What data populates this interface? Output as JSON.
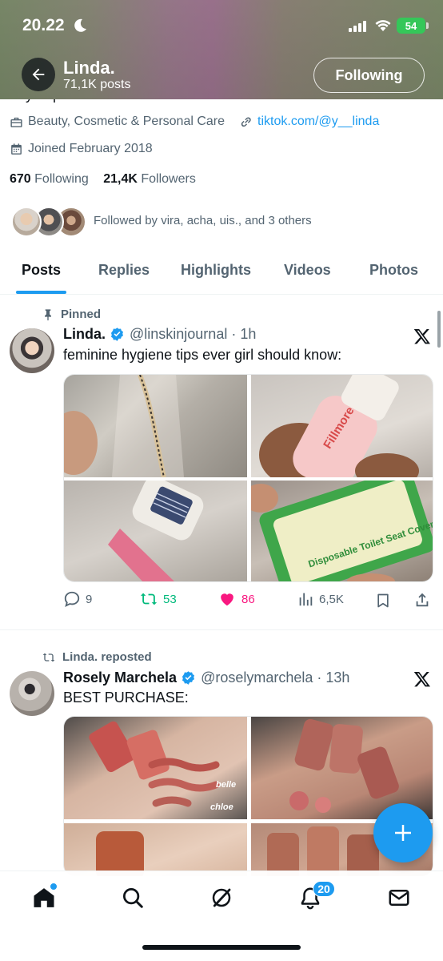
{
  "status_bar": {
    "time": "20.22",
    "battery": "54"
  },
  "header": {
    "name": "Linda.",
    "posts_count": "71,1K posts",
    "following_button": "Following"
  },
  "profile": {
    "bio_cut": "any inquiries:",
    "category": "Beauty, Cosmetic & Personal Care",
    "link": "tiktok.com/@y__linda",
    "joined": "Joined February 2018",
    "following_count": "670",
    "following_label": "Following",
    "followers_count": "21,4K",
    "followers_label": "Followers",
    "followed_by": "Followed by vira, acha, uis., and 3 others"
  },
  "tabs": [
    "Posts",
    "Replies",
    "Highlights",
    "Videos",
    "Photos"
  ],
  "posts": [
    {
      "context": "Pinned",
      "context_icon": "pin-icon",
      "name": "Linda.",
      "handle": "@linskinjournal",
      "time": "1h",
      "text": "feminine hygiene tips ever girl should know:",
      "images": [
        "bag-photo",
        "fillmore-bottle-photo",
        "razor-photo",
        "toilet-seat-cover-photo"
      ],
      "image_texts": {
        "bottle_brand": "Fillmore",
        "seat_cover": "Disposable Toilet Seat Cover"
      },
      "replies": "9",
      "reposts": "53",
      "likes": "86",
      "views": "6,5K"
    },
    {
      "context": "Linda. reposted",
      "context_icon": "repost-icon",
      "name": "Rosely Marchela",
      "handle": "@roselymarchela",
      "time": "13h",
      "text": "BEST PURCHASE:",
      "images": [
        "lip-swatch-photo",
        "lip-tint-palm-photo",
        "lip-tint-closeup-photo",
        "lip-tint-bottles-photo"
      ],
      "image_texts": {
        "swatch_1": "belle",
        "swatch_2": "chloe"
      }
    }
  ],
  "bottom_nav": {
    "items": [
      "home-icon",
      "search-icon",
      "grok-icon",
      "bell-icon",
      "mail-icon"
    ],
    "notifications_badge": "20"
  },
  "colors": {
    "accent": "#1d9bf0",
    "like": "#f91880",
    "repost": "#00ba7c",
    "text_secondary": "#536471"
  }
}
